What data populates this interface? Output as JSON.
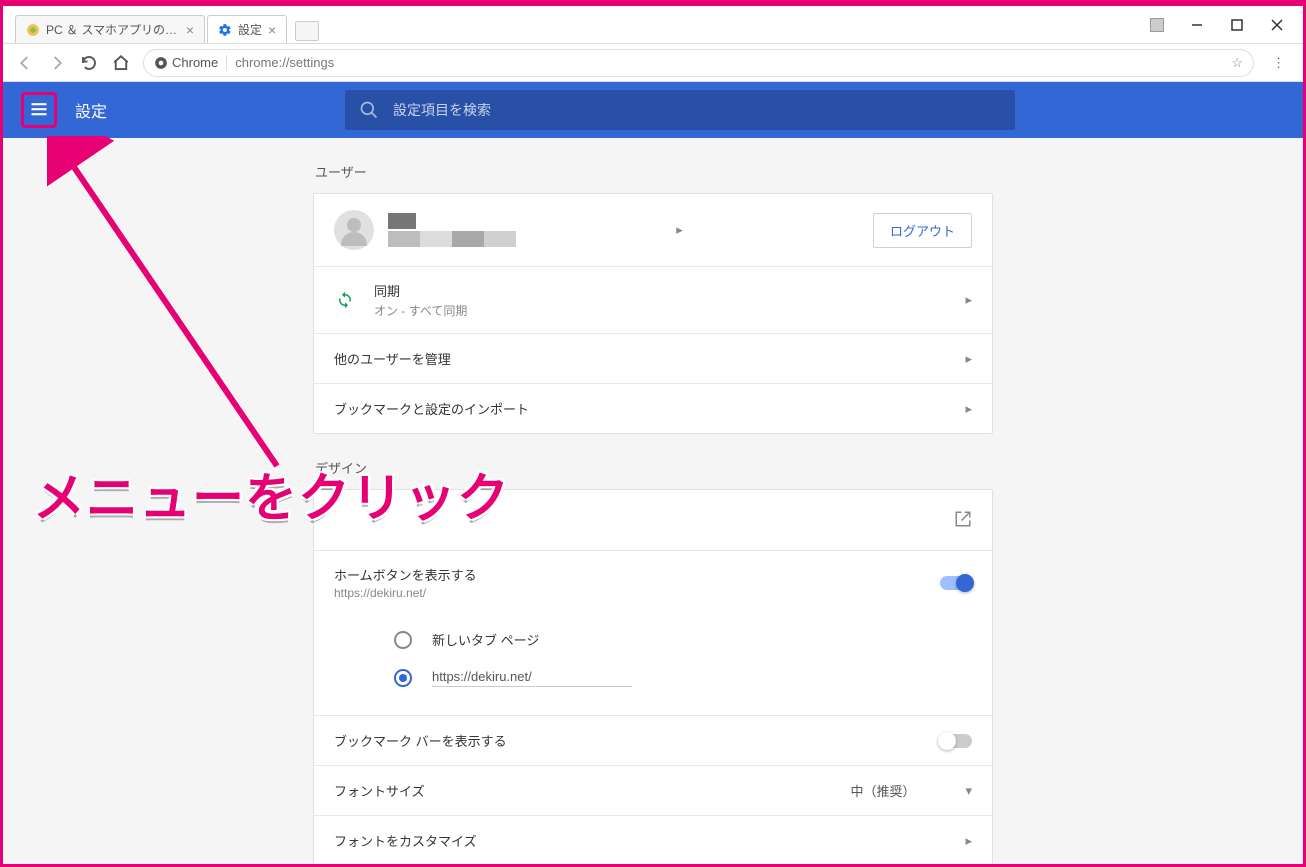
{
  "browser": {
    "tabs": [
      {
        "label": "PC ＆ スマホアプリの使い方"
      },
      {
        "label": "設定"
      }
    ],
    "chrome_chip": "Chrome",
    "url": "chrome://settings"
  },
  "header": {
    "title": "設定",
    "search_placeholder": "設定項目を検索"
  },
  "sections": {
    "user": {
      "title": "ユーザー",
      "logout": "ログアウト",
      "sync_label": "同期",
      "sync_status": "オン - すべて同期",
      "manage_others": "他のユーザーを管理",
      "import": "ブックマークと設定のインポート"
    },
    "design": {
      "title": "デザイン",
      "home_label": "ホームボタンを表示する",
      "home_sub": "https://dekiru.net/",
      "radio_newtab": "新しいタブ ページ",
      "radio_url": "https://dekiru.net/",
      "bookmark_bar": "ブックマーク バーを表示する",
      "font_size": "フォントサイズ",
      "font_size_value": "中（推奨）",
      "font_custom": "フォントをカスタマイズ"
    }
  },
  "annotation": "メニューをクリック"
}
